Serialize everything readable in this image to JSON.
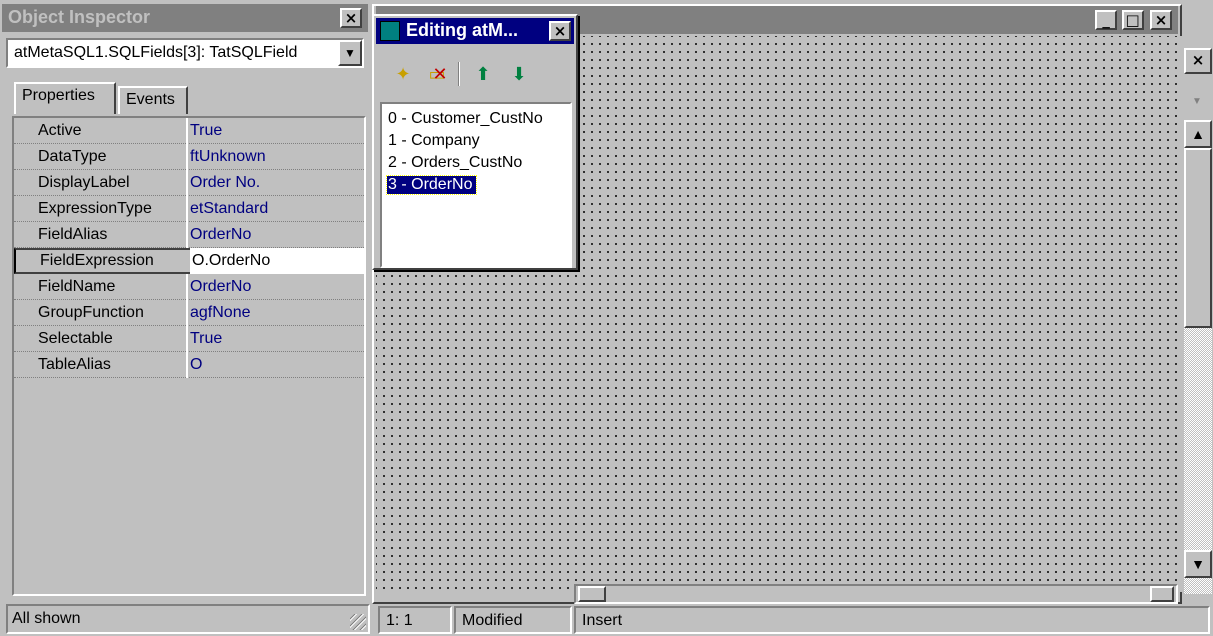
{
  "inspector": {
    "title": "Object Inspector",
    "object_combo": "atMetaSQL1.SQLFields[3]: TatSQLField",
    "tabs": {
      "properties": "Properties",
      "events": "Events"
    },
    "properties": [
      {
        "name": "Active",
        "value": "True"
      },
      {
        "name": "DataType",
        "value": "ftUnknown"
      },
      {
        "name": "DisplayLabel",
        "value": "Order No."
      },
      {
        "name": "ExpressionType",
        "value": "etStandard"
      },
      {
        "name": "FieldAlias",
        "value": "OrderNo"
      },
      {
        "name": "FieldExpression",
        "value": "O.OrderNo"
      },
      {
        "name": "FieldName",
        "value": "OrderNo"
      },
      {
        "name": "GroupFunction",
        "value": "agfNone"
      },
      {
        "name": "Selectable",
        "value": "True"
      },
      {
        "name": "TableAlias",
        "value": "O"
      }
    ],
    "status": "All shown"
  },
  "editor": {
    "title": "Editing atM...",
    "toolbar": {
      "new_icon": "new-item-icon",
      "delete_icon": "delete-item-icon",
      "up_icon": "arrow-up-icon",
      "down_icon": "arrow-down-icon"
    },
    "items": [
      "0 - Customer_CustNo",
      "1 - Company",
      "2 - Orders_CustNo",
      "3 - OrderNo"
    ],
    "selected_index": 3
  },
  "form_window": {
    "buttons": {
      "minimize": "_",
      "maximize": "□",
      "close": "×"
    }
  },
  "statusbar": {
    "position": "1:  1",
    "modified": "Modified",
    "mode": "Insert"
  },
  "colors": {
    "face": "#c0c0c0",
    "active_title": "#000080",
    "inactive_title": "#808080",
    "value_text": "#000080"
  }
}
